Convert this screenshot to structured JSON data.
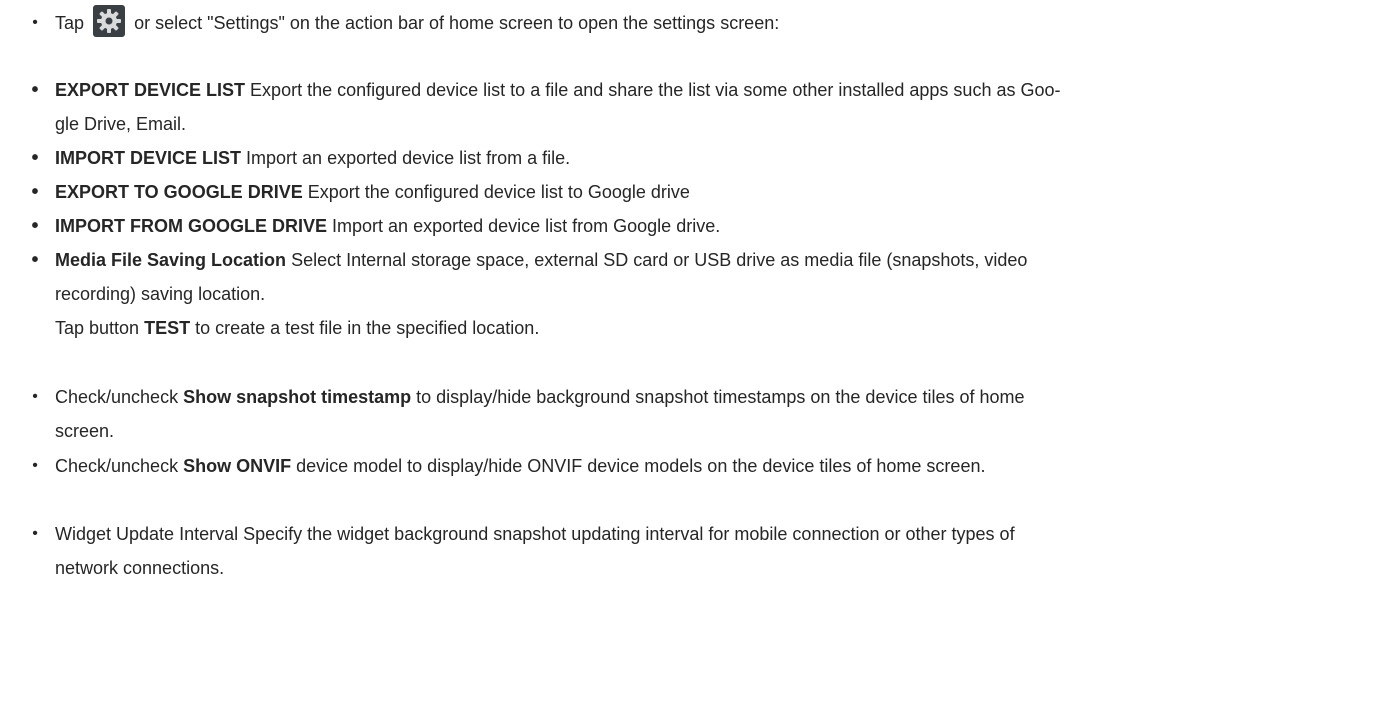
{
  "items": [
    {
      "pre": "Tap",
      "post": "or select \"Settings\" on the action bar of home screen to open the settings screen:",
      "icon": "gear-icon"
    },
    {
      "label": "EXPORT DEVICE LIST",
      "line1": "Export the configured device list to a file and share the list via some other installed apps such as Goo-",
      "line2": "gle Drive, Email."
    },
    {
      "label": "IMPORT DEVICE LIST",
      "text": "Import an exported device list from a file."
    },
    {
      "label": "EXPORT TO GOOGLE DRIVE",
      "text": "Export the configured device list to Google drive"
    },
    {
      "label": "IMPORT FROM GOOGLE DRIVE",
      "text": "Import an exported device list from Google drive."
    },
    {
      "label": "Media File Saving Location",
      "line1": "Select Internal storage space, external SD card or USB drive as media file (snapshots, video",
      "line2": "recording) saving location.",
      "line3_pre": "Tap button",
      "line3_bold": "TEST",
      "line3_post": "to create a test file in the specified location."
    },
    {
      "pre": "Check/uncheck",
      "bold": "Show snapshot timestamp",
      "post": "to display/hide background snapshot timestamps on the device tiles of home",
      "line2": "screen."
    },
    {
      "pre": "Check/uncheck",
      "bold": "Show ONVIF",
      "post": "device model to display/hide ONVIF device models on the device tiles of home screen."
    },
    {
      "line1": "Widget Update Interval Specify the widget background snapshot updating interval for mobile connection or other types of",
      "line2": "network connections."
    }
  ],
  "bullet_char": "•"
}
